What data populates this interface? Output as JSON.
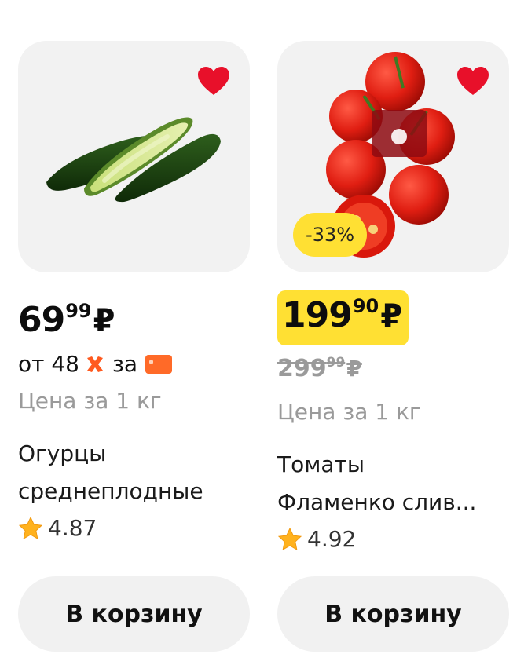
{
  "colors": {
    "accent_yellow": "#ffe033",
    "favorite_red": "#e8102a",
    "promo_orange": "#ff5a1f",
    "muted_gray": "#9a9a9a",
    "card_bg": "#f2f2f2"
  },
  "products": [
    {
      "image_name": "cucumbers",
      "favorite_icon": "heart-icon",
      "price": {
        "main": "69",
        "kopecks": "99",
        "currency": "₽"
      },
      "promo": {
        "prefix": "от",
        "amount": "48",
        "middle": "за"
      },
      "unit": "Цена за 1 кг",
      "name_lines": [
        "Огурцы",
        "среднеплодные"
      ],
      "rating": "4.87",
      "cart_label": "В корзину"
    },
    {
      "image_name": "tomatoes-flamenco",
      "favorite_icon": "heart-icon",
      "discount": "-33%",
      "price": {
        "main": "199",
        "kopecks": "90",
        "currency": "₽"
      },
      "old_price": {
        "main": "299",
        "kopecks": "99",
        "currency": "₽"
      },
      "unit": "Цена за 1 кг",
      "name_lines": [
        "Томаты",
        "Фламенко слив..."
      ],
      "rating": "4.92",
      "cart_label": "В корзину"
    }
  ]
}
